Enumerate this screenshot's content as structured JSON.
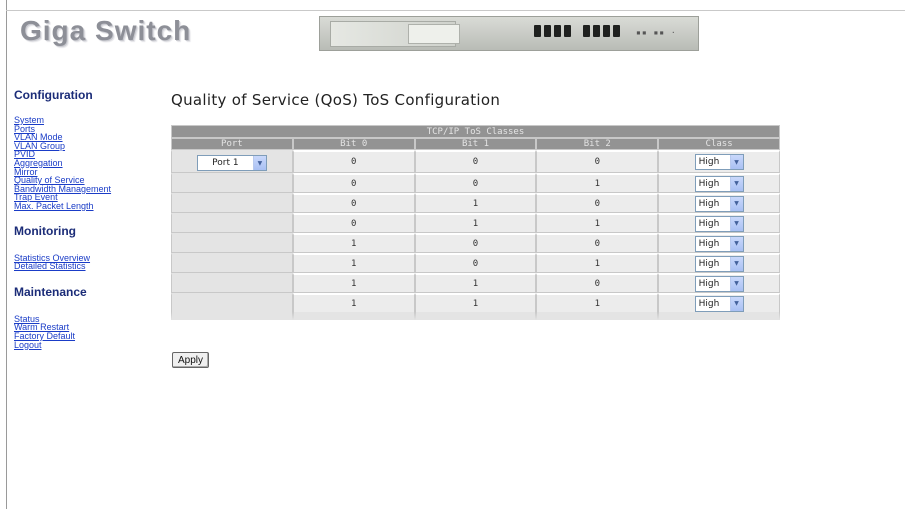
{
  "header": {
    "logo": "Giga Switch",
    "device_leds": "▪▪ ▪▪ ·"
  },
  "sidebar": {
    "configuration": {
      "title": "Configuration",
      "links": [
        "System",
        "Ports",
        "VLAN Mode",
        "VLAN Group",
        "PVID",
        "Aggregation",
        "Mirror",
        "Quality of Service",
        "Bandwidth Management",
        "Trap Event",
        "Max. Packet Length"
      ]
    },
    "monitoring": {
      "title": "Monitoring",
      "links": [
        "Statistics Overview",
        "Detailed Statistics"
      ]
    },
    "maintenance": {
      "title": "Maintenance",
      "links": [
        "Status",
        "Warm Restart",
        "Factory Default",
        "Logout"
      ]
    }
  },
  "main": {
    "title": "Quality of Service (QoS) ToS Configuration",
    "table": {
      "caption": "TCP/IP ToS Classes",
      "headers": [
        "Port",
        "Bit 0",
        "Bit 1",
        "Bit 2",
        "Class"
      ],
      "port_select": "Port 1",
      "rows": [
        {
          "b0": "0",
          "b1": "0",
          "b2": "0",
          "cls": "High"
        },
        {
          "b0": "0",
          "b1": "0",
          "b2": "1",
          "cls": "High"
        },
        {
          "b0": "0",
          "b1": "1",
          "b2": "0",
          "cls": "High"
        },
        {
          "b0": "0",
          "b1": "1",
          "b2": "1",
          "cls": "High"
        },
        {
          "b0": "1",
          "b1": "0",
          "b2": "0",
          "cls": "High"
        },
        {
          "b0": "1",
          "b1": "0",
          "b2": "1",
          "cls": "High"
        },
        {
          "b0": "1",
          "b1": "1",
          "b2": "0",
          "cls": "High"
        },
        {
          "b0": "1",
          "b1": "1",
          "b2": "1",
          "cls": "High"
        }
      ]
    },
    "apply_label": "Apply"
  }
}
